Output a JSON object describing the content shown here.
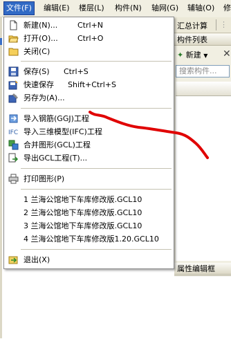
{
  "menubar": {
    "items": [
      {
        "label": "文件(F)",
        "active": true
      },
      {
        "label": "编辑(E)"
      },
      {
        "label": "楼层(L)"
      },
      {
        "label": "构件(N)"
      },
      {
        "label": "轴网(G)"
      },
      {
        "label": "辅轴(O)"
      },
      {
        "label": "修"
      }
    ]
  },
  "toolbar": {
    "calc_label": "汇总计算"
  },
  "component_list": {
    "title": "构件列表",
    "new_label": "新建",
    "search_placeholder": "搜索构件..."
  },
  "property_panel": {
    "title": "属性编辑框"
  },
  "file_menu": {
    "items": [
      {
        "label": "新建(N)...",
        "shortcut": "Ctrl+N",
        "icon": "new-file-icon"
      },
      {
        "label": "打开(O)...",
        "shortcut": "Ctrl+O",
        "icon": "open-folder-icon"
      },
      {
        "label": "关闭(C)",
        "icon": "close-folder-icon"
      },
      {
        "label": "保存(S)",
        "shortcut": "Ctrl+S",
        "icon": "save-icon"
      },
      {
        "label": "快速保存",
        "shortcut": "Shift+Ctrl+S",
        "icon": "quick-save-icon"
      },
      {
        "label": "另存为(A)...",
        "icon": "save-as-icon"
      },
      {
        "label": "导入钢筋(GGJ)工程",
        "icon": "import-rebar-icon"
      },
      {
        "label": "导入三维模型(IFC)工程",
        "icon": "import-ifc-icon"
      },
      {
        "label": "合并图形(GCL)工程",
        "icon": "merge-icon"
      },
      {
        "label": "导出GCL工程(T)...",
        "icon": "export-icon"
      },
      {
        "label": "打印图形(P)",
        "icon": "print-icon"
      },
      {
        "label": "1 兰海公馆地下车库修改版.GCL10"
      },
      {
        "label": "2 兰海公馆地下车库修改版.GCL10"
      },
      {
        "label": "3 兰海公馆地下车库修改版.GCL10"
      },
      {
        "label": "4 兰海公馆地下车库修改版1.20.GCL10"
      },
      {
        "label": "退出(X)",
        "icon": "exit-icon"
      }
    ]
  },
  "colors": {
    "highlight": "#316ac5",
    "annotation_stroke": "#e00000"
  }
}
